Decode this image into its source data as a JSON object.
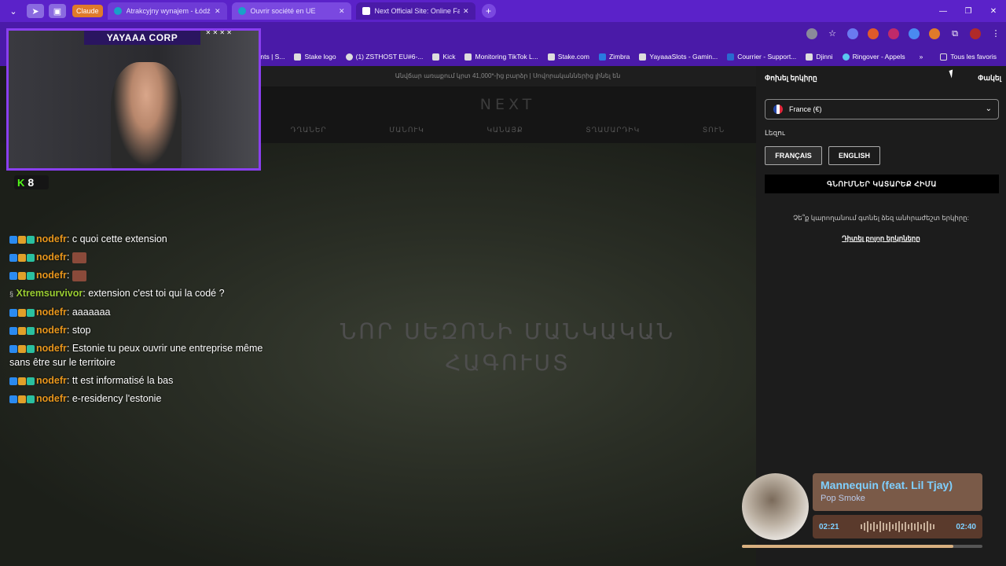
{
  "browser": {
    "claude_pill": "Claude",
    "tabs": [
      {
        "title": "Atrakcyjny wynajem - Łódź - sp",
        "favicon_color": "#19a0c8"
      },
      {
        "title": "Ouvrir société en UE",
        "favicon_color": "#19a0c8"
      },
      {
        "title": "Next Official Site: Online Fashio",
        "favicon_color": "#ffffff"
      }
    ],
    "new_tab": "+",
    "bookmarks": [
      {
        "label": "ments | S..."
      },
      {
        "label": "Stake logo"
      },
      {
        "label": "(1) ZSTHOST EU#6-..."
      },
      {
        "label": "Kick"
      },
      {
        "label": "Monitoring TikTok L..."
      },
      {
        "label": "Stake.com"
      },
      {
        "label": "Zimbra"
      },
      {
        "label": "YayaaaSlots - Gamin..."
      },
      {
        "label": "Courrier - Support..."
      },
      {
        "label": "Djinni"
      },
      {
        "label": "Ringover - Appels"
      }
    ],
    "bookmarks_more": "»",
    "all_favorites": "Tous les favoris"
  },
  "site": {
    "promo": "Անվճար առաքում կրտ 41,000*-ից բարձր | Սովորականներից լինել են",
    "logo": "NEXT",
    "nav": [
      "ԴՂԱՆԵՐ",
      "ՄԱՆՈՒԿ",
      "ԿԱՆԱՅՔ",
      "ՏՂԱՄԱՐԴԻԿ",
      "ՏՈՒՆ"
    ],
    "hero_line1": "ՆՈՐ ՍԵԶՈՆԻ ՄԱՆԿԱԿԱՆ",
    "hero_line2": "ՀԱԳՈՒՍՏ"
  },
  "stream": {
    "cam_title": "YAYAAA CORP",
    "cam_stars": "✕ ✕ ✕ ✕",
    "kick_logo": "K",
    "viewers": "8",
    "chat": [
      {
        "user": "nodefr",
        "text": "c quoi cette extension",
        "color": "orange"
      },
      {
        "user": "nodefr",
        "text": "",
        "emote": true,
        "color": "orange"
      },
      {
        "user": "nodefr",
        "text": "",
        "emote": true,
        "color": "orange"
      },
      {
        "user": "Xtremsurvivor",
        "text": "extension c'est toi qui la codé ?",
        "color": "green"
      },
      {
        "user": "nodefr",
        "text": "aaaaaaa",
        "color": "orange"
      },
      {
        "user": "nodefr",
        "text": "stop",
        "color": "orange"
      },
      {
        "user": "nodefr",
        "text": "Estonie tu peux ouvrir une entreprise même sans être sur le territoire",
        "color": "orange"
      },
      {
        "user": "nodefr",
        "text": "tt est informatisé la bas",
        "color": "orange"
      },
      {
        "user": "nodefr",
        "text": "e-residency l'estonie",
        "color": "orange"
      }
    ]
  },
  "panel": {
    "title": "Փոխել երկիրը",
    "close": "Փակել",
    "country": "France (€)",
    "language_label": "Լեզու",
    "lang_fr": "FRANÇAIS",
    "lang_en": "ENGLISH",
    "shop_button": "ԳՆՈՒՄՆԵՐ ԿԱՏԱՐԵՔ ՀԻՄԱ",
    "help_text": "Չե՞ք կարողանում գտնել ձեզ անհրաժեշտ երկիրը:",
    "help_link": "Դիտել բոլոր երկրները"
  },
  "music": {
    "song": "Mannequin (feat. Lil Tjay)",
    "artist": "Pop Smoke",
    "elapsed": "02:21",
    "total": "02:40",
    "progress": 0.88
  }
}
